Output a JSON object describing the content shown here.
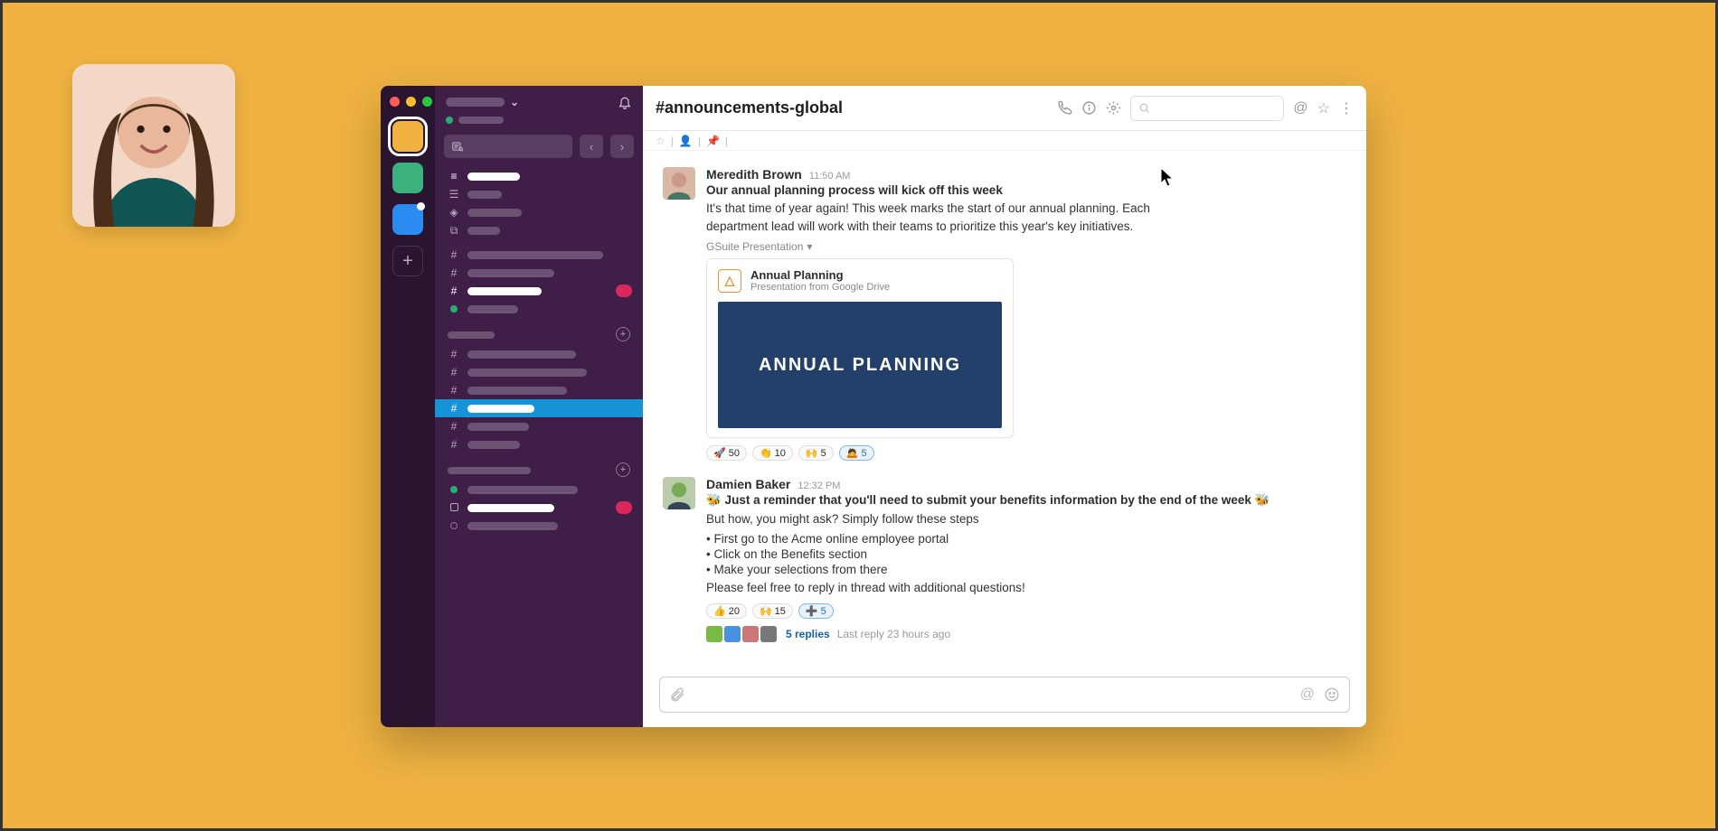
{
  "channel_name": "#announcements-global",
  "search_placeholder": "",
  "messages": [
    {
      "author": "Meredith Brown",
      "time": "11:50 AM",
      "title": "Our annual planning process will kick off this week",
      "text": "It's that time of year again! This week marks the start of our annual planning. Each department lead will work with their teams to prioritize this year's key initiatives.",
      "link_label": "GSuite Presentation",
      "file": {
        "name": "Annual Planning",
        "subtitle": "Presentation from Google Drive",
        "slide_text": "ANNUAL PLANNING"
      },
      "reactions": [
        {
          "emoji": "🚀",
          "count": 50
        },
        {
          "emoji": "👏",
          "count": 10
        },
        {
          "emoji": "🙌",
          "count": 5
        },
        {
          "emoji": "🙇",
          "count": 5,
          "highlight": true
        }
      ]
    },
    {
      "author": "Damien Baker",
      "time": "12:32 PM",
      "title": "🐝 Just a reminder that you'll need to submit your benefits information by the end of the week 🐝",
      "text": "But how, you might ask? Simply follow these steps",
      "bullets": [
        "• First go to the Acme online employee portal",
        "• Click on the Benefits section",
        "• Make your selections from there"
      ],
      "closing": "Please feel free to reply in thread with additional questions!",
      "reactions": [
        {
          "emoji": "👍",
          "count": 20
        },
        {
          "emoji": "🙌",
          "count": 15
        },
        {
          "emoji": "➕",
          "count": 5,
          "highlight": true
        }
      ],
      "thread": {
        "replies_label": "5 replies",
        "last": "Last reply 23 hours ago"
      }
    }
  ]
}
